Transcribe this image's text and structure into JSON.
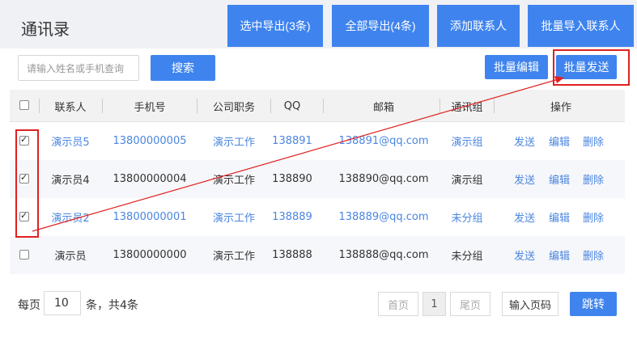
{
  "header": {
    "title": "通讯录",
    "buttons": [
      "选中导出(3条)",
      "全部导出(4条)",
      "添加联系人",
      "批量导入联系人"
    ]
  },
  "toolbar": {
    "search_placeholder": "请输入姓名或手机查询",
    "search_label": "搜索",
    "batch_edit_label": "批量编辑",
    "batch_send_label": "批量发送"
  },
  "table": {
    "columns": [
      "联系人",
      "手机号",
      "公司职务",
      "QQ",
      "邮箱",
      "通讯组",
      "操作"
    ],
    "rows": [
      {
        "name": "演示员5",
        "phone": "13800000005",
        "title": "演示工作",
        "qq": "138891",
        "email": "138891@qq.com",
        "group": "演示组",
        "checked": true,
        "selected": true
      },
      {
        "name": "演示员4",
        "phone": "13800000004",
        "title": "演示工作",
        "qq": "138890",
        "email": "138890@qq.com",
        "group": "演示组",
        "checked": true,
        "selected": false
      },
      {
        "name": "演示员2",
        "phone": "13800000001",
        "title": "演示工作",
        "qq": "138889",
        "email": "138889@qq.com",
        "group": "未分组",
        "checked": true,
        "selected": true
      },
      {
        "name": "演示员",
        "phone": "13800000000",
        "title": "演示工作",
        "qq": "138888",
        "email": "138888@qq.com",
        "group": "未分组",
        "checked": false,
        "selected": false
      }
    ],
    "actions": [
      "发送",
      "编辑",
      "删除"
    ]
  },
  "pager": {
    "per_page_label": "每页",
    "per_page_value": "10",
    "total_label": "条，共4条",
    "first_label": "首页",
    "current_page": "1",
    "last_label": "尾页",
    "goto_placeholder": "输入页码",
    "jump_label": "跳转"
  },
  "colors": {
    "accent": "#3f84ee",
    "annotation": "#e02020",
    "link": "#4a86e0"
  }
}
